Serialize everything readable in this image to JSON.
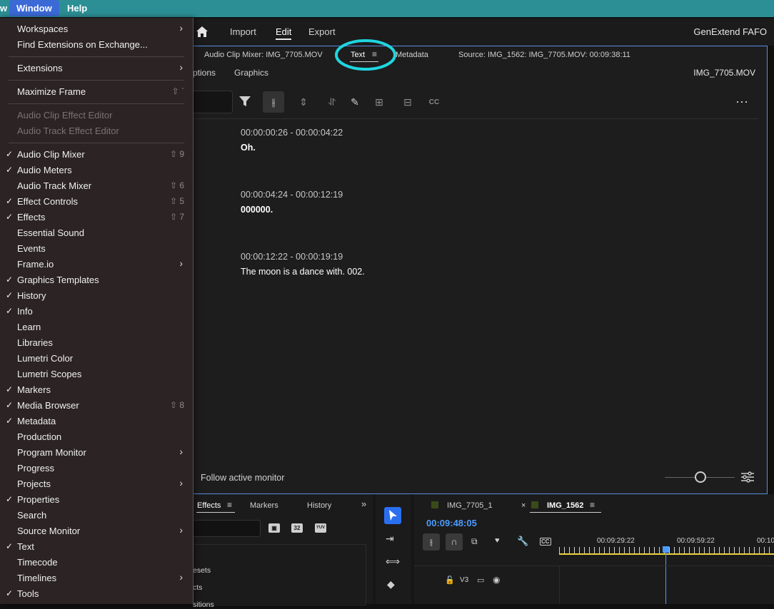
{
  "menubar": {
    "left_fragment": "w",
    "window": "Window",
    "help": "Help"
  },
  "header": {
    "nav": [
      "Import",
      "Edit",
      "Export"
    ],
    "project": "GenExtend FAFO"
  },
  "panel": {
    "tabs": {
      "audio_clip_mixer": "Audio Clip Mixer: IMG_7705.MOV",
      "text": "Text",
      "metadata": "Metadata",
      "source": "Source: IMG_1562: IMG_7705.MOV: 00:09:38:11"
    },
    "subtabs": {
      "captions": "ptions",
      "graphics": "Graphics",
      "clip": "IMG_7705.MOV"
    },
    "entries": [
      {
        "time": "00:00:00:26 - 00:00:04:22",
        "text": "Oh."
      },
      {
        "time": "00:00:04:24 - 00:00:12:19",
        "text": "000000."
      },
      {
        "time": "00:00:12:22 - 00:00:19:19",
        "text": "The moon is a dance with. 002."
      }
    ],
    "follow": "Follow active monitor"
  },
  "bottom": {
    "tabs": {
      "effects": "Effects",
      "markers": "Markers",
      "history": "History"
    },
    "effects_list": [
      "esets",
      "cts",
      "sitions"
    ],
    "seq_tabs": [
      "IMG_7705_1",
      "IMG_1562"
    ],
    "timecode": "00:09:48:05",
    "ruler": [
      "00:09:29:22",
      "00:09:59:22",
      "00:10"
    ],
    "track": "V3"
  },
  "menu": {
    "items": [
      {
        "label": "Workspaces",
        "submenu": true
      },
      {
        "label": "Find Extensions on Exchange..."
      },
      {
        "label": "Extensions",
        "submenu": true
      },
      {
        "label": "Maximize Frame",
        "shortcut": "⇧ `"
      },
      {
        "label": "Audio Clip Effect Editor",
        "disabled": true
      },
      {
        "label": "Audio Track Effect Editor",
        "disabled": true
      },
      {
        "label": "Audio Clip Mixer",
        "checked": true,
        "shortcut": "⇧ 9"
      },
      {
        "label": "Audio Meters",
        "checked": true
      },
      {
        "label": "Audio Track Mixer",
        "shortcut": "⇧ 6"
      },
      {
        "label": "Effect Controls",
        "checked": true,
        "shortcut": "⇧ 5"
      },
      {
        "label": "Effects",
        "checked": true,
        "shortcut": "⇧ 7"
      },
      {
        "label": "Essential Sound"
      },
      {
        "label": "Events"
      },
      {
        "label": "Frame.io",
        "submenu": true
      },
      {
        "label": "Graphics Templates",
        "checked": true
      },
      {
        "label": "History",
        "checked": true
      },
      {
        "label": "Info",
        "checked": true
      },
      {
        "label": "Learn"
      },
      {
        "label": "Libraries"
      },
      {
        "label": "Lumetri Color"
      },
      {
        "label": "Lumetri Scopes"
      },
      {
        "label": "Markers",
        "checked": true
      },
      {
        "label": "Media Browser",
        "checked": true,
        "shortcut": "⇧ 8"
      },
      {
        "label": "Metadata",
        "checked": true
      },
      {
        "label": "Production"
      },
      {
        "label": "Program Monitor",
        "submenu": true
      },
      {
        "label": "Progress"
      },
      {
        "label": "Projects",
        "submenu": true
      },
      {
        "label": "Properties",
        "checked": true
      },
      {
        "label": "Search"
      },
      {
        "label": "Source Monitor",
        "submenu": true
      },
      {
        "label": "Text",
        "checked": true
      },
      {
        "label": "Timecode"
      },
      {
        "label": "Timelines",
        "submenu": true
      },
      {
        "label": "Tools",
        "checked": true
      }
    ]
  },
  "colors": {
    "accent_blue": "#5a8ce0",
    "annotation_cyan": "#1fd6e0",
    "timecode_blue": "#4b9bff",
    "ruler_yellow": "#e8d23a"
  }
}
